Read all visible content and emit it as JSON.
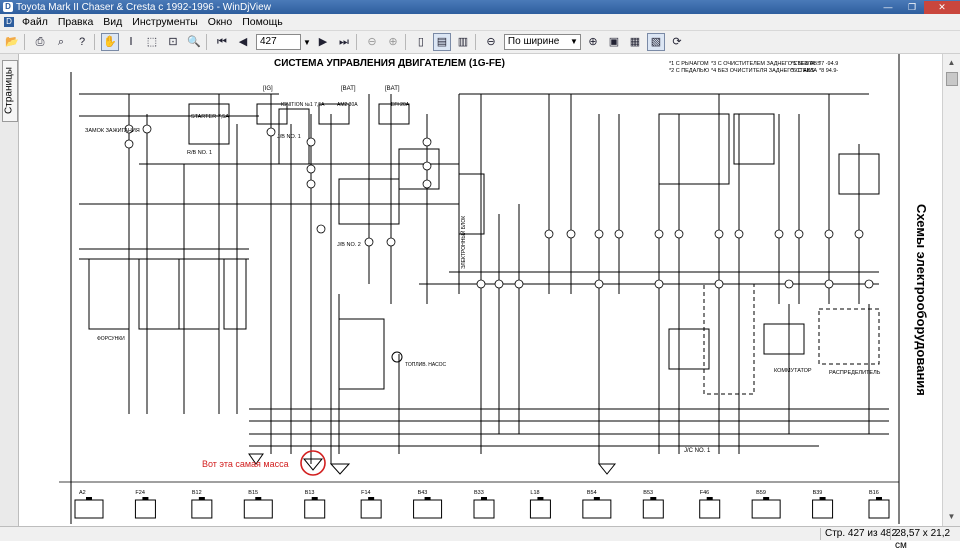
{
  "window": {
    "title": "Toyota Mark II Chaser & Cresta c 1992-1996 - WinDjView",
    "min_label": "—",
    "max_label": "❐",
    "close_label": "✕"
  },
  "menu": [
    "Файл",
    "Правка",
    "Вид",
    "Инструменты",
    "Окно",
    "Помощь"
  ],
  "toolbar": {
    "page_number": "427",
    "zoom_value": "По ширине"
  },
  "sidebar": {
    "tab_label": "Страницы"
  },
  "document": {
    "title": "СИСТЕМА УПРАВЛЕНИЯ ДВИГАТЕЛЕМ (1G-FE)",
    "side_heading": "Схемы электрооборудования",
    "annotation": "Вот эта самая масса",
    "annotation_color": "#d21f1f",
    "labels": {
      "lock": "ЗАМОК ЗАЖИГАНИЯ",
      "starter": "STARTER 7,5A",
      "rb": "R/B NO. 1",
      "ig": "[IG]",
      "ign": "IGNITION №1 7,5A",
      "jb1": "J/B NO. 1",
      "bat1": "[BAT]",
      "am2": "AM2 30A",
      "bat2": "[BAT]",
      "efi": "EFI 20A",
      "jb2": "J/B NO. 2",
      "jc1": "J/C NO. 1",
      "commutator": "КОММУТАТОР",
      "distributor": "РАСПРЕДЕЛИТЕЛЬ",
      "fuel_pump": "ТОПЛИВ. НАСОС",
      "ecu": "ЭЛЕКТРОННЫЙ БЛОК",
      "injectors": "ФОРСУНКИ",
      "note1": "*1 С РЫЧАГОМ",
      "note2": "*2 С ПЕДАЛЬЮ",
      "note3": "*3 С ОЧИСТИТЕЛЕМ ЗАДНЕГО СТЕКЛА",
      "note4": "*4 БЕЗ ОЧИСТИТЕЛЯ ЗАДНЕГО СТЕКЛА",
      "note5": "*5 БЕЗ ABS",
      "note6": "*6 С ABS",
      "note7": "*7 -94.9",
      "note8": "*8 94.9-"
    },
    "connectors": [
      "A2",
      "F24",
      "B12",
      "B15",
      "B13",
      "F14",
      "B43",
      "B33",
      "L18",
      "B54",
      "B53",
      "F46",
      "B59",
      "B39",
      "B16"
    ]
  },
  "status": {
    "page_of": "Стр. 427 из 482",
    "size": "28,57 x 21,2 см"
  }
}
